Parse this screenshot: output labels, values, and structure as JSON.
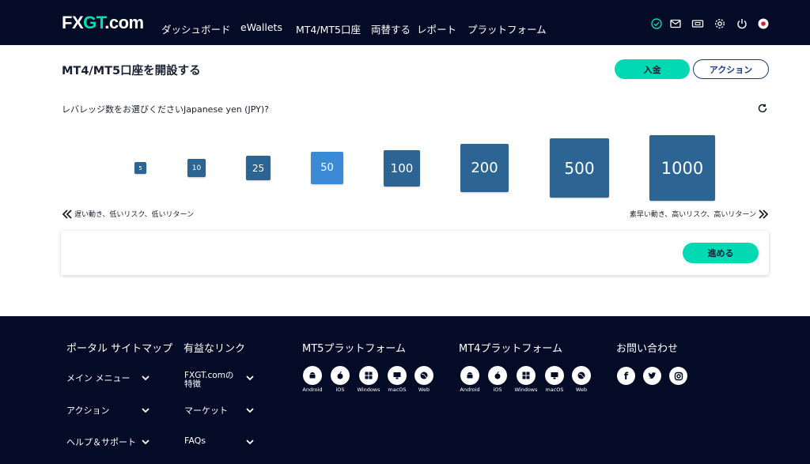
{
  "brand": {
    "logo_a": "FX",
    "logo_b": "GT",
    "logo_c": ".com"
  },
  "nav": [
    "ダッシュボード",
    "eWallets",
    "MT4/MT5口座",
    "両替する",
    "レポート",
    "プラットフォーム"
  ],
  "header_icons": [
    "check-circle-icon",
    "mail-icon",
    "ticket-icon",
    "gear-icon",
    "power-icon",
    "japan-flag-icon"
  ],
  "page": {
    "title": "MT4/MT5口座を開設する",
    "deposit_label": "入金",
    "action_label": "アクション",
    "question": "レバレッジ数をお選びくださいJapanese yen (JPY)?",
    "leverage_options": [
      "5",
      "10",
      "25",
      "50",
      "100",
      "200",
      "500",
      "1000"
    ],
    "selected_leverage": "50",
    "slow_label": "遅い動き、低いリスク、低いリターン",
    "fast_label": "素早い動き、高いリスク、高いリターン",
    "next_label": "進める"
  },
  "footer": {
    "portal": {
      "heading": "ポータル サイトマップ",
      "items": [
        "メイン メニュー",
        "アクション",
        "ヘルプ＆サポート"
      ]
    },
    "links": {
      "heading": "有益なリンク",
      "items": [
        "FXGT.comの特徴",
        "マーケット",
        "FAQs"
      ]
    },
    "mt5": {
      "heading": "MT5プラットフォーム",
      "platforms": [
        "Android",
        "iOS",
        "Windows",
        "macOS",
        "Web"
      ]
    },
    "mt4": {
      "heading": "MT4プラットフォーム",
      "platforms": [
        "Android",
        "iOS",
        "Windows",
        "macOS",
        "Web"
      ]
    },
    "contact": {
      "heading": "お問い合わせ",
      "social": [
        "facebook-icon",
        "twitter-icon",
        "instagram-icon"
      ]
    }
  },
  "colors": {
    "accent": "#00d9b2",
    "navy": "#030b26",
    "tile": "#2c6594",
    "tile_selected": "#3b8ad6",
    "outline": "#1c3a8a"
  }
}
